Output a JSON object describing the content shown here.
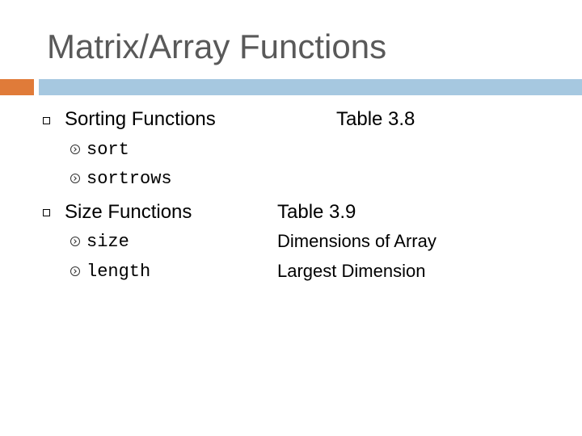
{
  "slide": {
    "title": "Matrix/Array Functions",
    "accent_color": "#E07B39",
    "bar_color": "#A6C8E0",
    "sections": [
      {
        "heading": "Sorting Functions",
        "table": "Table 3.8",
        "items": [
          {
            "code": "sort",
            "description": ""
          },
          {
            "code": "sortrows",
            "description": ""
          }
        ]
      },
      {
        "heading": "Size Functions",
        "table": "Table 3.9",
        "items": [
          {
            "code": "size",
            "description": "Dimensions of Array"
          },
          {
            "code": "length",
            "description": "Largest Dimension"
          }
        ]
      }
    ]
  }
}
